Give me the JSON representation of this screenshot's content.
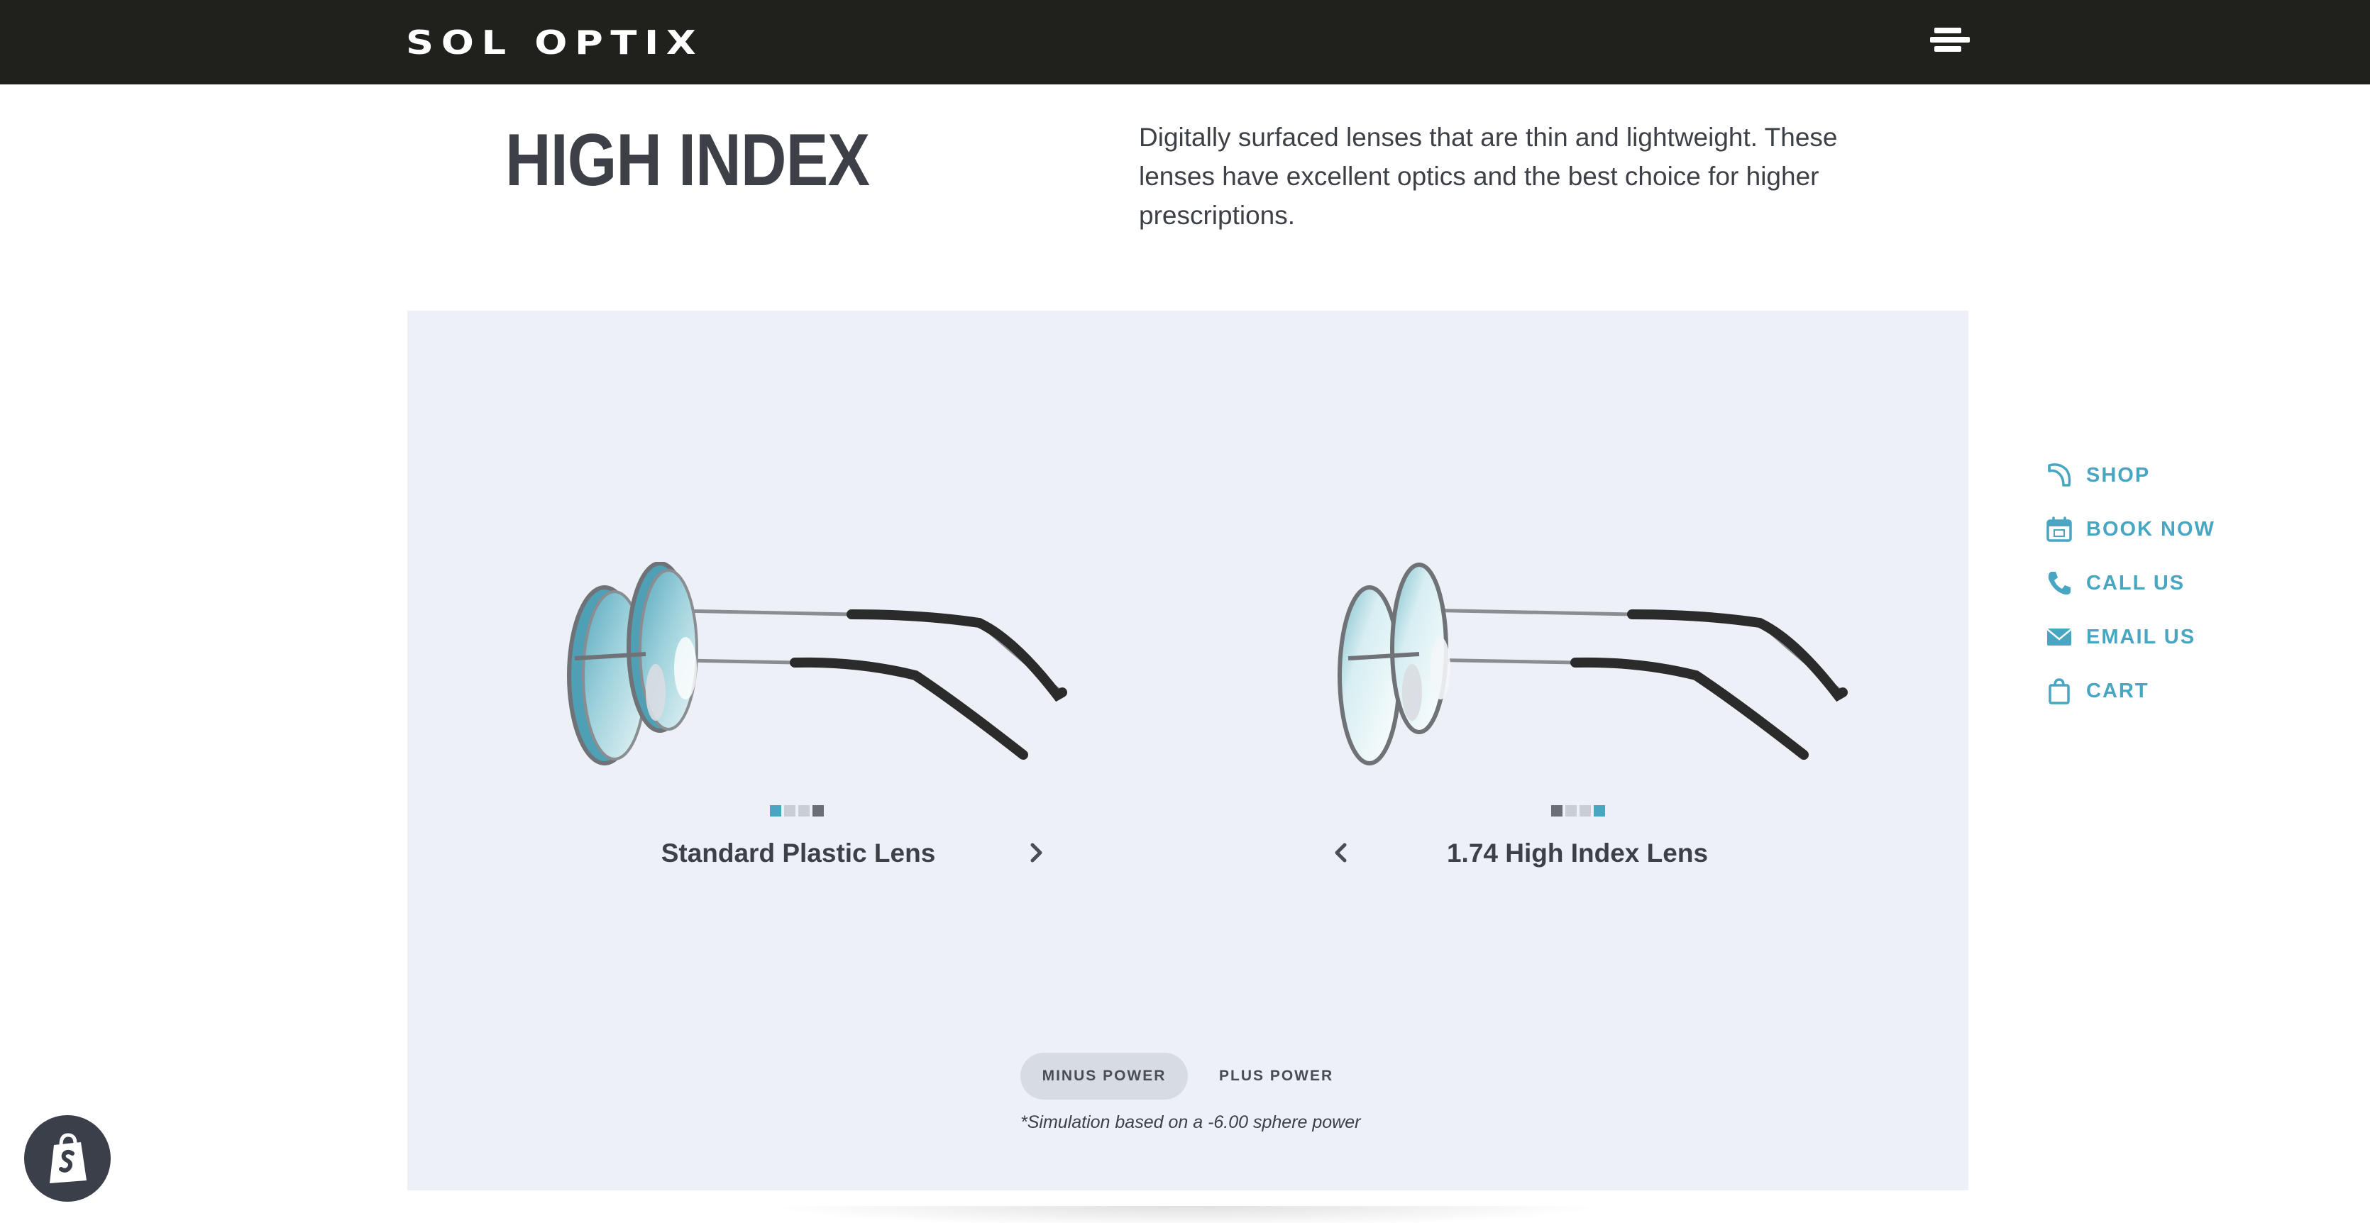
{
  "header": {
    "logo_text": "SOL OPTIX",
    "menu_icon": "hamburger-menu-icon"
  },
  "intro": {
    "title": "HIGH INDEX",
    "description": "Digitally surfaced lenses that are thin and lightweight. These lenses have excellent optics and the best choice for higher prescriptions."
  },
  "compare": {
    "left": {
      "label": "Standard Plastic Lens",
      "active_dot": 0,
      "dot_count": 4
    },
    "right": {
      "label": "1.74 High Index Lens",
      "active_dot": 3,
      "dot_count": 4
    },
    "toggle": {
      "minus_label": "MINUS POWER",
      "plus_label": "PLUS POWER",
      "selected": "MINUS POWER"
    },
    "note": "*Simulation based on a -6.00 sphere power"
  },
  "quick_links": [
    {
      "label": "SHOP",
      "icon": "lens-icon"
    },
    {
      "label": "BOOK NOW",
      "icon": "calendar-icon"
    },
    {
      "label": "CALL US",
      "icon": "phone-icon"
    },
    {
      "label": "EMAIL US",
      "icon": "envelope-icon"
    },
    {
      "label": "CART",
      "icon": "shopping-bag-icon"
    }
  ],
  "colors": {
    "header_bg": "#20201d",
    "accent": "#48a6c2",
    "panel_bg": "#edf0f7",
    "text": "#3d4046"
  }
}
